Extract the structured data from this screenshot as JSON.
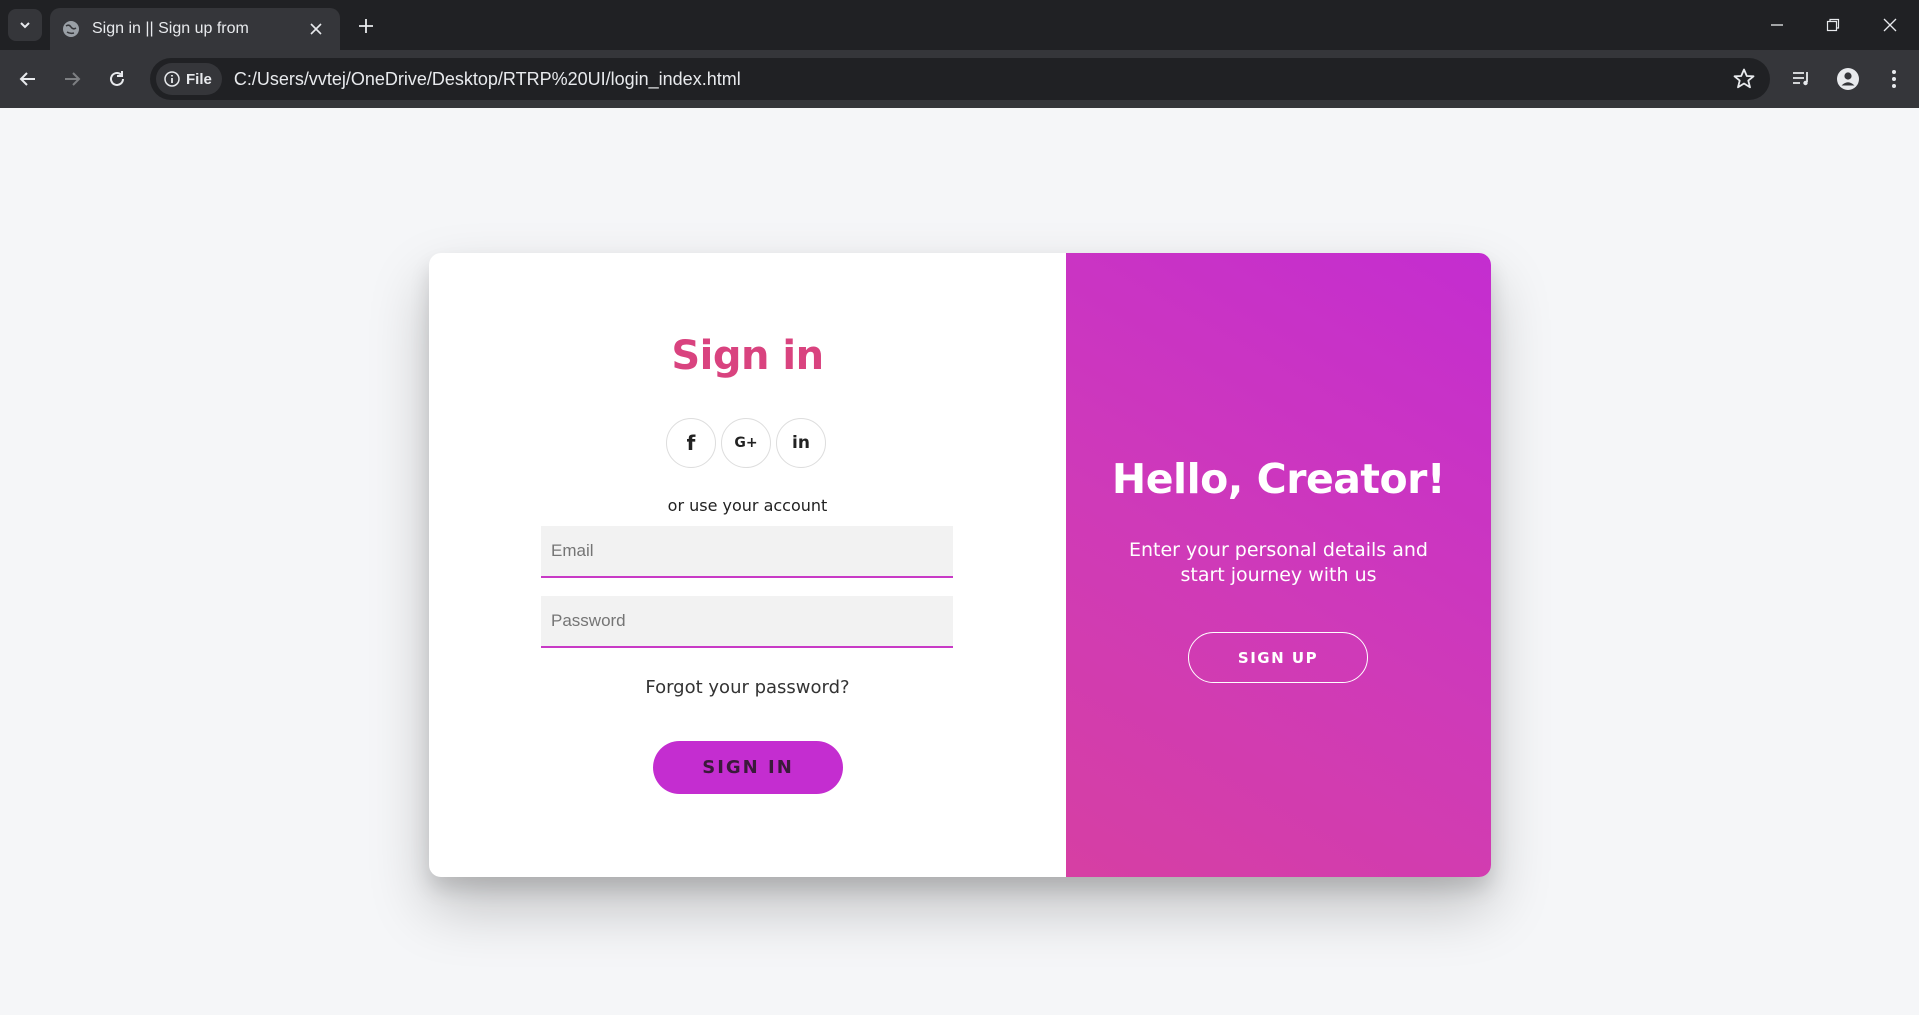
{
  "browser": {
    "tab_title": "Sign in || Sign up from",
    "site_chip": "File",
    "url": "C:/Users/vvtej/OneDrive/Desktop/RTRP%20UI/login_index.html",
    "icons": [
      "tab-search-icon",
      "globe-icon",
      "close-icon",
      "plus-icon",
      "minimize-icon",
      "restore-icon",
      "window-close-icon",
      "back-icon",
      "forward-icon",
      "reload-icon",
      "info-icon",
      "star-icon",
      "reading-list-icon",
      "profile-icon",
      "menu-icon"
    ]
  },
  "signin": {
    "title": "Sign in",
    "social": {
      "facebook": "f",
      "google": "G+",
      "linkedin": "in"
    },
    "or_text": "or use your account",
    "email_placeholder": "Email",
    "password_placeholder": "Password",
    "forgot": "Forgot your password?",
    "button": "SIGN IN"
  },
  "overlay": {
    "title": "Hello, Creator!",
    "subtitle": "Enter your personal details and start journey with us",
    "button": "SIGN UP"
  },
  "colors": {
    "accent": "#c42dd0",
    "title_pink": "#d9437f",
    "gradient_end": "#d63fa3"
  }
}
